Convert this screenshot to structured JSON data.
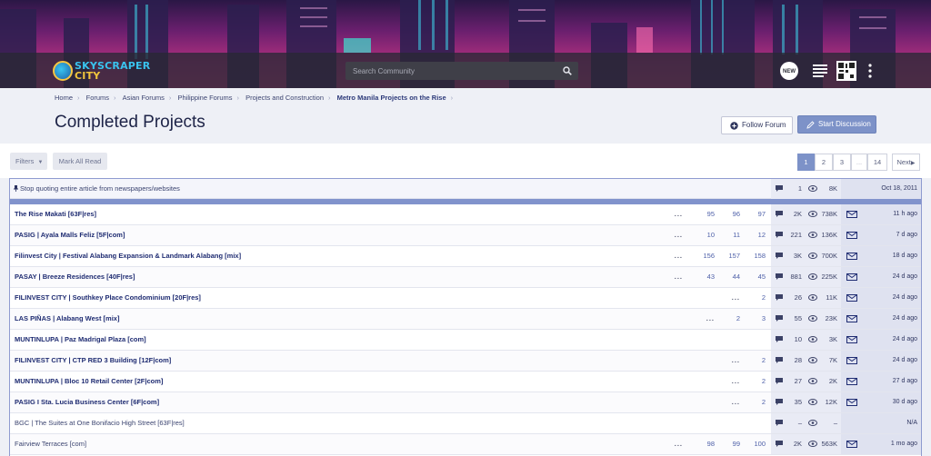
{
  "header": {
    "logo_line1": "SKYSCRAPER",
    "logo_line2": "CITY",
    "search_placeholder": "Search Community",
    "new_badge": "NEW",
    "icons": [
      "search-icon",
      "new-posts-icon",
      "list-icon",
      "qr-code-icon",
      "more-icon"
    ]
  },
  "breadcrumb": [
    "Home",
    "Forums",
    "Asian Forums",
    "Philippine Forums",
    "Projects and Construction",
    "Metro Manila Projects on the Rise"
  ],
  "page": {
    "title": "Completed Projects",
    "follow_label": "Follow Forum",
    "start_label": "Start Discussion"
  },
  "toolbar": {
    "filters_label": "Filters",
    "mark_all_read": "Mark All Read",
    "pages": [
      "1",
      "2",
      "3",
      "...",
      "14"
    ],
    "next_label": "Next"
  },
  "sticky": {
    "title": "Stop quoting entire article from newspapers/websites",
    "replies": "1",
    "views": "8K",
    "last": "Oct 18, 2011"
  },
  "threads": [
    {
      "title": "The Rise Makati [63F|res]",
      "pages": [
        "...",
        "95",
        "96",
        "97"
      ],
      "replies": "2K",
      "views": "738K",
      "last": "11 h ago",
      "bold": true,
      "mail": true
    },
    {
      "title": "PASIG | Ayala Malls Feliz [5F|com]",
      "pages": [
        "...",
        "10",
        "11",
        "12"
      ],
      "replies": "221",
      "views": "136K",
      "last": "7 d ago",
      "bold": true,
      "mail": true
    },
    {
      "title": "Filinvest City | Festival Alabang Expansion & Landmark Alabang [mix]",
      "pages": [
        "...",
        "156",
        "157",
        "158"
      ],
      "replies": "3K",
      "views": "700K",
      "last": "18 d ago",
      "bold": true,
      "mail": true
    },
    {
      "title": "PASAY | Breeze Residences [40F|res]",
      "pages": [
        "...",
        "43",
        "44",
        "45"
      ],
      "replies": "881",
      "views": "225K",
      "last": "24 d ago",
      "bold": true,
      "mail": true
    },
    {
      "title": "FILINVEST CITY | Southkey Place Condominium [20F|res]",
      "pages": [
        "...",
        "2"
      ],
      "replies": "26",
      "views": "11K",
      "last": "24 d ago",
      "bold": true,
      "mail": true
    },
    {
      "title": "LAS PIÑAS | Alabang West [mix]",
      "pages": [
        "...",
        "2",
        "3"
      ],
      "replies": "55",
      "views": "23K",
      "last": "24 d ago",
      "bold": true,
      "mail": true
    },
    {
      "title": "MUNTINLUPA | Paz Madrigal Plaza [com]",
      "pages": [],
      "replies": "10",
      "views": "3K",
      "last": "24 d ago",
      "bold": true,
      "mail": true
    },
    {
      "title": "FILINVEST CITY | CTP RED 3 Building [12F|com]",
      "pages": [
        "...",
        "2"
      ],
      "replies": "28",
      "views": "7K",
      "last": "24 d ago",
      "bold": true,
      "mail": true
    },
    {
      "title": "MUNTINLUPA | Bloc 10 Retail Center [2F|com]",
      "pages": [
        "...",
        "2"
      ],
      "replies": "27",
      "views": "2K",
      "last": "27 d ago",
      "bold": true,
      "mail": true
    },
    {
      "title": "PASIG I Sta. Lucia Business Center [6F|com]",
      "pages": [
        "...",
        "2"
      ],
      "replies": "35",
      "views": "12K",
      "last": "30 d ago",
      "bold": true,
      "mail": true
    },
    {
      "title": "BGC | The Suites at One Bonifacio High Street [63F|res]",
      "pages": [],
      "replies": "–",
      "views": "–",
      "last": "N/A",
      "bold": false,
      "mail": false
    },
    {
      "title": "Fairview Terraces [com]",
      "pages": [
        "...",
        "98",
        "99",
        "100"
      ],
      "replies": "2K",
      "views": "563K",
      "last": "1 mo ago",
      "bold": false,
      "mail": true
    }
  ],
  "colors": {
    "accent": "#7d92c8",
    "link": "#1f2c72",
    "banner_magenta": "#c53b7f"
  }
}
